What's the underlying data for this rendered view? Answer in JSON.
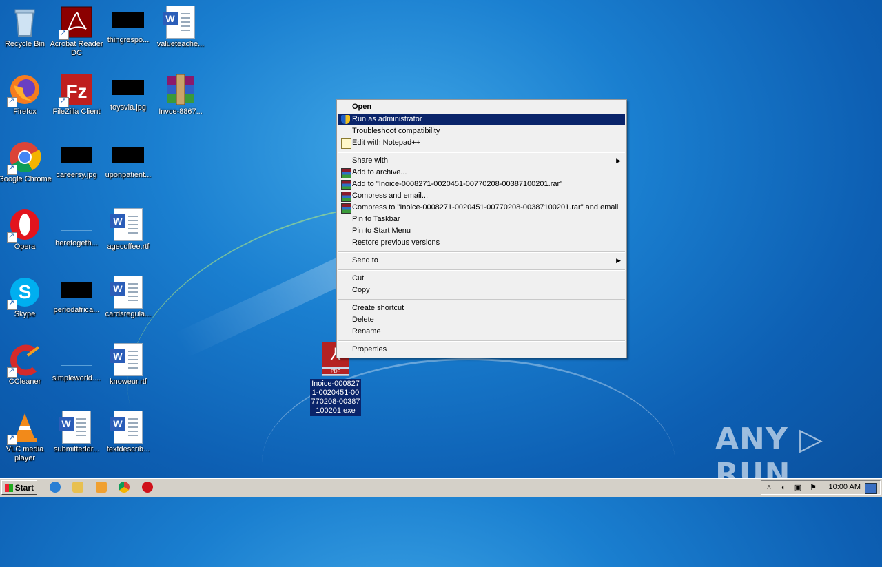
{
  "desktop": {
    "icons": [
      {
        "label": "Recycle Bin"
      },
      {
        "label": "Acrobat Reader DC"
      },
      {
        "label": "thingrespo..."
      },
      {
        "label": "valueteache..."
      },
      {
        "label": "Firefox"
      },
      {
        "label": "FileZilla Client"
      },
      {
        "label": "toysvia.jpg"
      },
      {
        "label": "Invce-8867..."
      },
      {
        "label": "Google Chrome"
      },
      {
        "label": "careersy.jpg"
      },
      {
        "label": "uponpatient..."
      },
      {
        "label": "Opera"
      },
      {
        "label": "heretogeth..."
      },
      {
        "label": "agecoffee.rtf"
      },
      {
        "label": "Skype"
      },
      {
        "label": "periodafrica..."
      },
      {
        "label": "cardsregula..."
      },
      {
        "label": "CCleaner"
      },
      {
        "label": "simpleworld...."
      },
      {
        "label": "knoweur.rtf"
      },
      {
        "label": "VLC media player"
      },
      {
        "label": "submitteddr..."
      },
      {
        "label": "textdescrib..."
      }
    ],
    "selected_file": {
      "label": "Inoice-0008271-0020451-00770208-00387100201.exe",
      "icon_text": "PDF"
    }
  },
  "context_menu": {
    "open": "Open",
    "run_as_admin": "Run as administrator",
    "troubleshoot": "Troubleshoot compatibility",
    "edit_notepad": "Edit with Notepad++",
    "share_with": "Share with",
    "add_archive": "Add to archive...",
    "add_to_rar": "Add to \"Inoice-0008271-0020451-00770208-00387100201.rar\"",
    "compress_email": "Compress and email...",
    "compress_to_rar_email": "Compress to \"Inoice-0008271-0020451-00770208-00387100201.rar\" and email",
    "pin_taskbar": "Pin to Taskbar",
    "pin_start": "Pin to Start Menu",
    "restore_versions": "Restore previous versions",
    "send_to": "Send to",
    "cut": "Cut",
    "copy": "Copy",
    "create_shortcut": "Create shortcut",
    "delete": "Delete",
    "rename": "Rename",
    "properties": "Properties"
  },
  "taskbar": {
    "start": "Start",
    "clock": "10:00 AM"
  },
  "watermark": "ANY ▷ RUN"
}
